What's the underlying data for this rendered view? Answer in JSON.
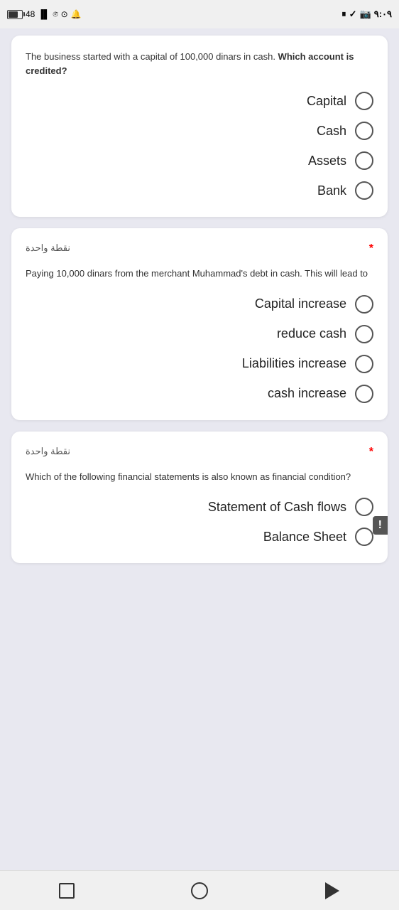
{
  "statusBar": {
    "battery": "48",
    "signal": "K/s",
    "time": "٩:٠٩",
    "icons": [
      "pause",
      "check",
      "camera",
      "battery-right"
    ]
  },
  "questions": [
    {
      "id": "q1",
      "meta": null,
      "asterisk": null,
      "questionText": "The business started with a capital of 100,000 dinars in cash. Which account is credited?",
      "questionHtml": "The business started with a capital of 100,000 dinars in cash. <strong>Which account is credited?</strong>",
      "options": [
        {
          "id": "q1o1",
          "label": "Capital"
        },
        {
          "id": "q1o2",
          "label": "Cash"
        },
        {
          "id": "q1o3",
          "label": "Assets"
        },
        {
          "id": "q1o4",
          "label": "Bank"
        }
      ]
    },
    {
      "id": "q2",
      "meta": "نقطة واحدة",
      "asterisk": "*",
      "questionText": "Paying 10,000 dinars from the merchant Muhammad's debt in cash. This will lead to",
      "options": [
        {
          "id": "q2o1",
          "label": "Capital increase"
        },
        {
          "id": "q2o2",
          "label": "reduce cash"
        },
        {
          "id": "q2o3",
          "label": "Liabilities increase"
        },
        {
          "id": "q2o4",
          "label": "cash increase"
        }
      ]
    },
    {
      "id": "q3",
      "meta": "نقطة واحدة",
      "asterisk": "*",
      "questionText": "Which of the following financial statements is also known as financial condition?",
      "options": [
        {
          "id": "q3o1",
          "label": "Statement of Cash flows"
        },
        {
          "id": "q3o2",
          "label": "Balance Sheet"
        }
      ]
    }
  ],
  "bottomNav": {
    "square": "□",
    "circle": "○",
    "triangle": "◁"
  },
  "toastIcon": "!"
}
